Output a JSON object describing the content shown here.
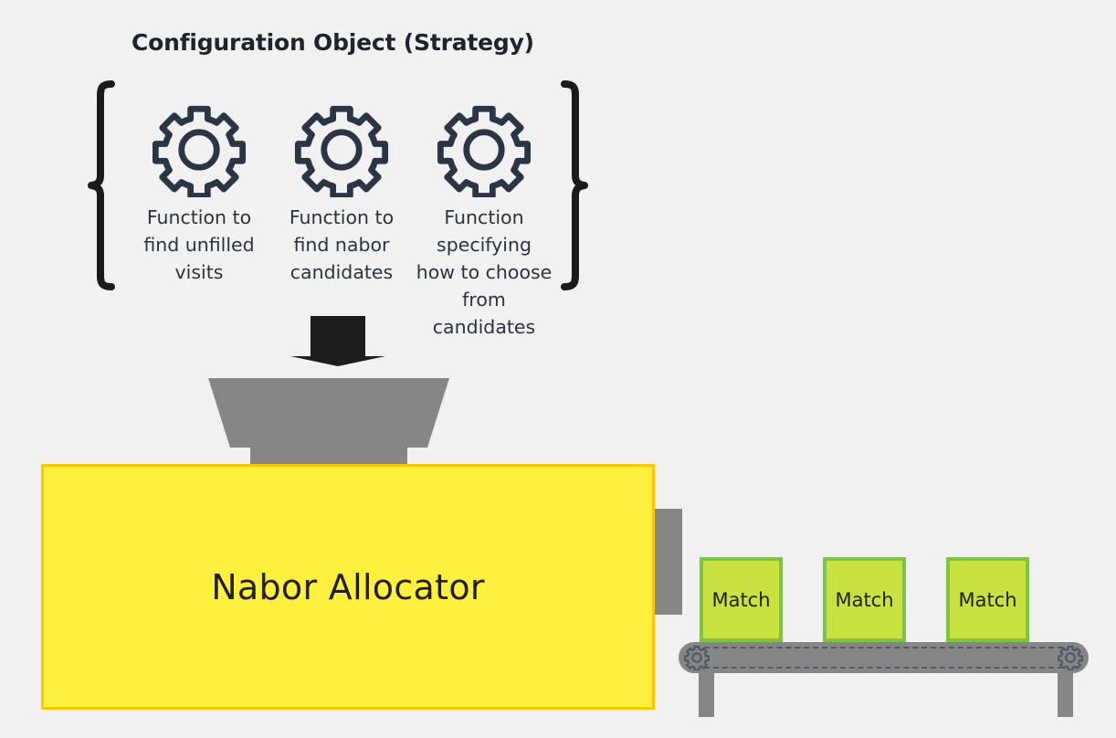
{
  "diagram": {
    "background_color": "#f1f1f1",
    "title": "Configuration Object (Strategy)",
    "strategy": {
      "brace_color": "#1b1b1b",
      "gear_color": "#2b3544",
      "items": [
        {
          "icon": "gear-icon",
          "label": "Function to find unfilled visits"
        },
        {
          "icon": "gear-icon",
          "label": "Function to find nabor candidates"
        },
        {
          "icon": "gear-icon",
          "label": "Function specifying how to choose from candidates"
        }
      ]
    },
    "arrow": {
      "icon": "down-arrow-icon",
      "color": "#1c1c1c",
      "direction": "down"
    },
    "funnel": {
      "icon": "funnel-icon",
      "color": "#868686"
    },
    "machine": {
      "label": "Nabor Allocator",
      "fill_color": "#ffef3f",
      "border_color": "#fdc500",
      "text_color": "#1f1f1f"
    },
    "output_chute": {
      "color": "#868686"
    },
    "conveyor": {
      "belt_color": "#868686",
      "dash_color": "#4e5a68",
      "gear_icon": "gear-icon",
      "leg_count": 2,
      "outputs": [
        {
          "label": "Match",
          "fill_color": "#c9e23f",
          "border_color": "#7ec24b"
        },
        {
          "label": "Match",
          "fill_color": "#c9e23f",
          "border_color": "#7ec24b"
        },
        {
          "label": "Match",
          "fill_color": "#c9e23f",
          "border_color": "#7ec24b"
        }
      ]
    }
  }
}
